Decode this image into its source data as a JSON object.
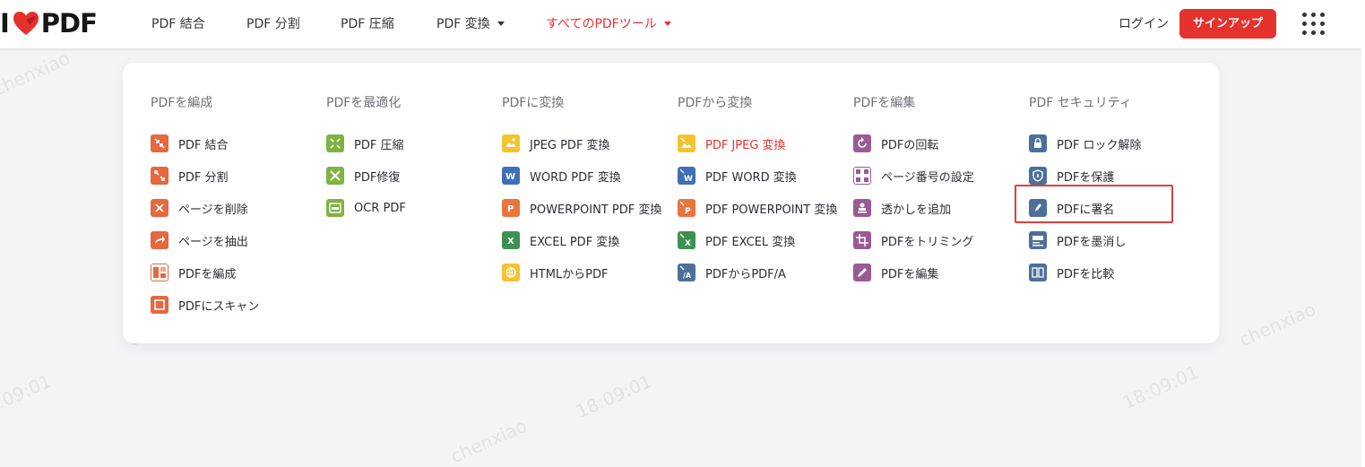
{
  "header": {
    "logo_text_left": "I",
    "logo_text_right": "PDF",
    "nav": [
      {
        "label": "PDF 結合",
        "has_caret": false
      },
      {
        "label": "PDF 分割",
        "has_caret": false
      },
      {
        "label": "PDF 圧縮",
        "has_caret": false
      },
      {
        "label": "PDF 変換",
        "has_caret": true
      },
      {
        "label": "すべてのPDFツール",
        "has_caret": true,
        "active": true
      }
    ],
    "login": "ログイン",
    "signup": "サインアップ"
  },
  "menu": {
    "columns": [
      {
        "title": "PDFを編成",
        "items": [
          {
            "label": "PDF 結合",
            "icon": "merge-icon"
          },
          {
            "label": "PDF 分割",
            "icon": "split-icon"
          },
          {
            "label": "ページを削除",
            "icon": "delete-pages-icon"
          },
          {
            "label": "ページを抽出",
            "icon": "extract-pages-icon"
          },
          {
            "label": "PDFを編成",
            "icon": "organize-icon"
          },
          {
            "label": "PDFにスキャン",
            "icon": "scan-icon"
          }
        ]
      },
      {
        "title": "PDFを最適化",
        "items": [
          {
            "label": "PDF 圧縮",
            "icon": "compress-icon"
          },
          {
            "label": "PDF修復",
            "icon": "repair-icon"
          },
          {
            "label": "OCR PDF",
            "icon": "ocr-icon"
          }
        ]
      },
      {
        "title": "PDFに変換",
        "items": [
          {
            "label": "JPEG PDF 変換",
            "icon": "jpg-to-pdf-icon"
          },
          {
            "label": "WORD PDF 変換",
            "icon": "word-to-pdf-icon"
          },
          {
            "label": "POWERPOINT PDF 変換",
            "icon": "ppt-to-pdf-icon"
          },
          {
            "label": "EXCEL PDF 変換",
            "icon": "excel-to-pdf-icon"
          },
          {
            "label": "HTMLからPDF",
            "icon": "html-to-pdf-icon"
          }
        ]
      },
      {
        "title": "PDFから変換",
        "items": [
          {
            "label": "PDF JPEG 変換",
            "icon": "pdf-to-jpg-icon",
            "highlight": true
          },
          {
            "label": "PDF WORD 変換",
            "icon": "pdf-to-word-icon"
          },
          {
            "label": "PDF POWERPOINT 変換",
            "icon": "pdf-to-ppt-icon"
          },
          {
            "label": "PDF EXCEL 変換",
            "icon": "pdf-to-excel-icon"
          },
          {
            "label": "PDFからPDF/A",
            "icon": "pdf-to-pdfa-icon"
          }
        ]
      },
      {
        "title": "PDFを編集",
        "items": [
          {
            "label": "PDFの回転",
            "icon": "rotate-icon"
          },
          {
            "label": "ページ番号の設定",
            "icon": "page-numbers-icon"
          },
          {
            "label": "透かしを追加",
            "icon": "watermark-icon"
          },
          {
            "label": "PDFをトリミング",
            "icon": "crop-icon"
          },
          {
            "label": "PDFを編集",
            "icon": "edit-icon"
          }
        ]
      },
      {
        "title": "PDF セキュリティ",
        "items": [
          {
            "label": "PDF ロック解除",
            "icon": "unlock-icon"
          },
          {
            "label": "PDFを保護",
            "icon": "protect-icon"
          },
          {
            "label": "PDFに署名",
            "icon": "sign-icon"
          },
          {
            "label": "PDFを墨消し",
            "icon": "redact-icon"
          },
          {
            "label": "PDFを比較",
            "icon": "compare-icon"
          }
        ]
      }
    ]
  },
  "colors": {
    "brand_red": "#e5322d",
    "organize": "#e5683e",
    "optimize": "#7fb341",
    "convert_jpg": "#f4c430",
    "word": "#3f6fb5",
    "powerpoint": "#e9753e",
    "excel": "#3e9151",
    "edit": "#9a5a93",
    "security": "#4c6f9b"
  },
  "watermark": {
    "text": "chenxiao",
    "time": "18:09:01"
  }
}
